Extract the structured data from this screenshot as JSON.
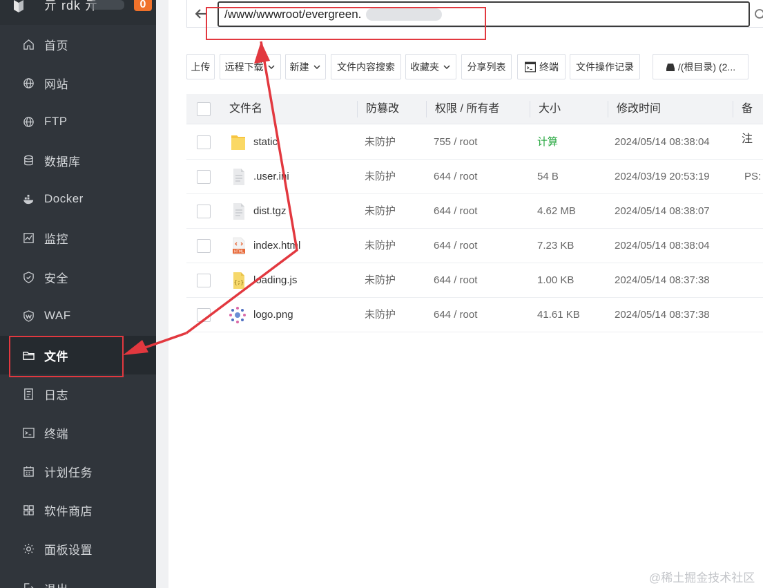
{
  "sidebar": {
    "top_name": "亓 rdk 亓",
    "top_badge": "0",
    "items": [
      {
        "label": "首页",
        "icon": "home-icon"
      },
      {
        "label": "网站",
        "icon": "globe-icon"
      },
      {
        "label": "FTP",
        "icon": "ftp-globe-icon"
      },
      {
        "label": "数据库",
        "icon": "database-icon"
      },
      {
        "label": "Docker",
        "icon": "docker-icon"
      },
      {
        "label": "监控",
        "icon": "monitor-icon"
      },
      {
        "label": "安全",
        "icon": "shield-icon"
      },
      {
        "label": "WAF",
        "icon": "waf-shield-icon"
      },
      {
        "label": "文件",
        "icon": "folder-icon"
      },
      {
        "label": "日志",
        "icon": "log-icon"
      },
      {
        "label": "终端",
        "icon": "terminal-icon"
      },
      {
        "label": "计划任务",
        "icon": "calendar-icon"
      },
      {
        "label": "软件商店",
        "icon": "apps-icon"
      },
      {
        "label": "面板设置",
        "icon": "gear-icon"
      },
      {
        "label": "退出",
        "icon": "logout-icon"
      }
    ],
    "active_index": 8
  },
  "path_bar": {
    "value": "/www/wwwroot/evergreen."
  },
  "toolbar": {
    "upload": "上传",
    "remote_download": "远程下载",
    "new": "新建",
    "content_search": "文件内容搜索",
    "favorites": "收藏夹",
    "share_list": "分享列表",
    "terminal": "终端",
    "op_log": "文件操作记录",
    "root_dir": "/(根目录) (2..."
  },
  "table": {
    "headers": {
      "name": "文件名",
      "protect": "防篡改",
      "perm": "权限 / 所有者",
      "size": "大小",
      "mtime": "修改时间",
      "note": "备注"
    },
    "rows": [
      {
        "name": "static",
        "icon": "folder-icon",
        "protect": "未防护",
        "perm": "755 / root",
        "size": "计算",
        "mtime": "2024/05/14 08:38:04",
        "note": ""
      },
      {
        "name": ".user.ini",
        "icon": "file-icon",
        "protect": "未防护",
        "perm": "644 / root",
        "size": "54 B",
        "mtime": "2024/03/19 20:53:19",
        "note": "PS:"
      },
      {
        "name": "dist.tgz",
        "icon": "file-icon",
        "protect": "未防护",
        "perm": "644 / root",
        "size": "4.62 MB",
        "mtime": "2024/05/14 08:38:07",
        "note": ""
      },
      {
        "name": "index.html",
        "icon": "html-file-icon",
        "protect": "未防护",
        "perm": "644 / root",
        "size": "7.23 KB",
        "mtime": "2024/05/14 08:38:04",
        "note": ""
      },
      {
        "name": "loading.js",
        "icon": "js-file-icon",
        "protect": "未防护",
        "perm": "644 / root",
        "size": "1.00 KB",
        "mtime": "2024/05/14 08:37:38",
        "note": ""
      },
      {
        "name": "logo.png",
        "icon": "image-file-icon",
        "protect": "未防护",
        "perm": "644 / root",
        "size": "41.61 KB",
        "mtime": "2024/05/14 08:37:38",
        "note": ""
      }
    ]
  },
  "watermark": "@稀土掘金技术社区",
  "colors": {
    "sidebar_bg": "#30353b",
    "active_bg": "#252a2f",
    "badge": "#f0712a",
    "annotation_red": "#e2383f",
    "calc_green": "#20a53a"
  }
}
